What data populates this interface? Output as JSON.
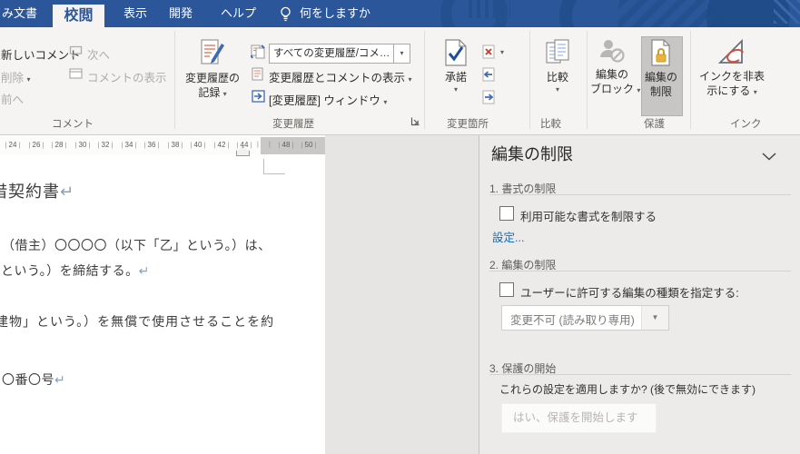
{
  "window": {
    "tabs": {
      "partial_left": "み文書",
      "review": "校閲",
      "view": "表示",
      "developer": "開発",
      "help": "ヘルプ"
    },
    "tell_me": "何をしますか"
  },
  "ribbon": {
    "comments": {
      "new_comment": "新しいコメント",
      "delete_btn": "削除",
      "previous": "前へ",
      "next": "次へ",
      "show_comments": "コメントの表示",
      "group_label": "コメント"
    },
    "tracking": {
      "track_changes_line1": "変更履歴の",
      "track_changes_line2": "記録",
      "display_for_review": "すべての変更履歴/コメ…",
      "show_markup": "変更履歴とコメントの表示",
      "reviewing_pane": "[変更履歴] ウィンドウ",
      "group_label": "変更履歴"
    },
    "changes": {
      "accept": "承諾",
      "group_label": "変更箇所"
    },
    "compare": {
      "compare_btn": "比較",
      "group_label": "比較"
    },
    "protect": {
      "block_line1": "編集の",
      "block_line2": "ブロック",
      "restrict_line1": "編集の",
      "restrict_line2": "制限",
      "group_label": "保護"
    },
    "ink": {
      "hide_line1": "インクを非表",
      "hide_line2": "示にする",
      "group_label": "インク"
    }
  },
  "ruler": {
    "numbers": [
      "24",
      "26",
      "28",
      "30",
      "32",
      "34",
      "36",
      "38",
      "40",
      "42",
      "44"
    ],
    "margin_numbers": [
      "48",
      "50"
    ]
  },
  "document": {
    "title": "借契約書",
    "line1": "（借主）〇〇〇〇（以下「乙」という。）は、",
    "line2": "という。）を締結する。",
    "line3": "建物」という。）を無償で使用させることを約",
    "line4": "〇番〇号",
    "return_mark": "↵"
  },
  "pane": {
    "title": "編集の制限",
    "formatting": {
      "heading": "1. 書式の制限",
      "checkbox_label": "利用可能な書式を制限する",
      "settings_link": "設定..."
    },
    "editing": {
      "heading": "2. 編集の制限",
      "checkbox_label": "ユーザーに許可する編集の種類を指定する:",
      "dropdown_value": "変更不可 (読み取り専用)"
    },
    "enforcement": {
      "heading": "3. 保護の開始",
      "question": "これらの設定を適用しますか? (後で無効にできます)",
      "start_button": "はい、保護を開始します"
    }
  },
  "icons": {
    "dropdown_arrow": "▾",
    "combo_arrow": "▾",
    "pane_dropdown_arrow": "▼"
  },
  "colors": {
    "titlebar_blue": "#2b579a",
    "accent_blue": "#2b579a",
    "link_blue": "#0f6cbd",
    "lock_gold": "#e0a930",
    "reject_red": "#c53929",
    "disabled_grey": "#aeacaa",
    "pane_background": "#edebe9"
  }
}
